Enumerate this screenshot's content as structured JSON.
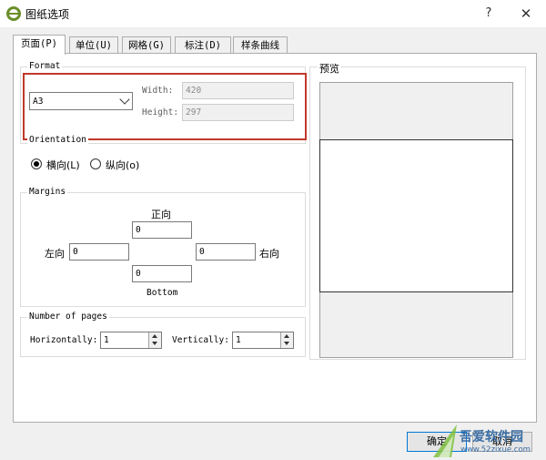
{
  "window": {
    "title": "图纸选项",
    "help_label": "?",
    "close_label": "✕"
  },
  "tabs": [
    {
      "label": "页面(P)",
      "active": true
    },
    {
      "label": "单位(U)",
      "active": false
    },
    {
      "label": "网格(G)",
      "active": false
    },
    {
      "label": "标注(D)",
      "active": false
    },
    {
      "label": "样条曲线",
      "active": false
    }
  ],
  "format": {
    "group_label": "Format",
    "paper_size": "A3",
    "width_label": "Width:",
    "width_value": "420",
    "height_label": "Height:",
    "height_value": "297"
  },
  "orientation": {
    "group_label": "Orientation",
    "landscape_label": "横向(L)",
    "portrait_label": "纵向(o)",
    "selected": "landscape"
  },
  "margins": {
    "group_label": "Margins",
    "top_label": "正向",
    "top_value": "0",
    "left_label": "左向",
    "left_value": "0",
    "right_value": "0",
    "right_label": "右向",
    "bottom_value": "0",
    "bottom_label": "Bottom"
  },
  "pages": {
    "group_label": "Number of pages",
    "horizontal_label": "Horizontally:",
    "horizontal_value": "1",
    "vertical_label": "Vertically:",
    "vertical_value": "1"
  },
  "preview": {
    "group_label": "预览"
  },
  "buttons": {
    "ok_label": "确定",
    "cancel_label": "取消"
  },
  "watermark": {
    "text": "吾爱软件园",
    "url": "www.52zixue.com"
  },
  "colors": {
    "highlight": "#c0392b",
    "accent": "#0078d7"
  }
}
